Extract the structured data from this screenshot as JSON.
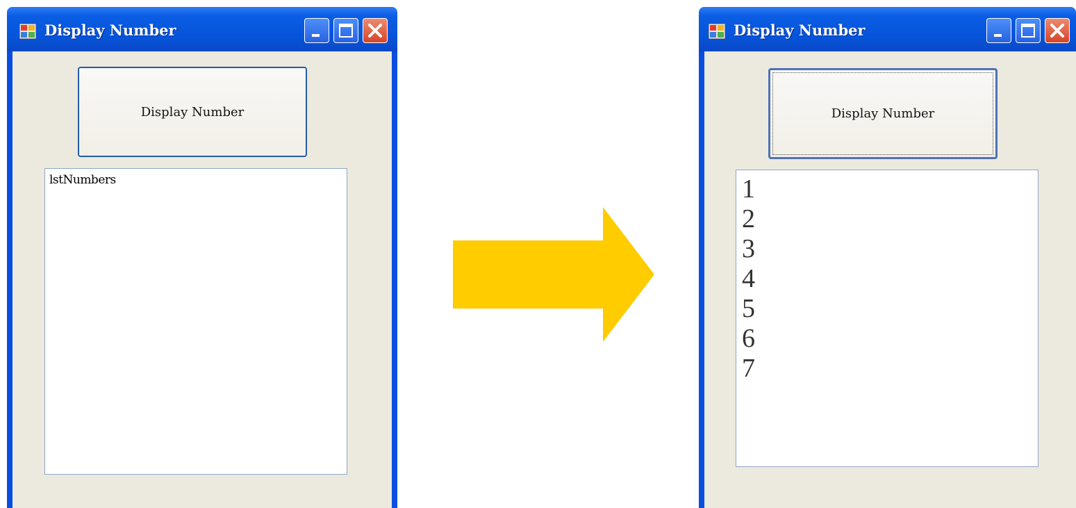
{
  "left_window": {
    "title": "Display Number",
    "button_label": "Display Number",
    "listbox_placeholder": "lstNumbers"
  },
  "right_window": {
    "title": "Display Number",
    "button_label": "Display Number",
    "list_items": [
      "1",
      "2",
      "3",
      "4",
      "5",
      "6",
      "7"
    ]
  },
  "colors": {
    "titlebar": "#0653d9",
    "window_face": "#ece9de",
    "arrow": "#ffcc00",
    "close_button": "#d7452a"
  },
  "icons": [
    "app-icon",
    "minimize-icon",
    "maximize-icon",
    "close-icon",
    "right-arrow-icon"
  ]
}
